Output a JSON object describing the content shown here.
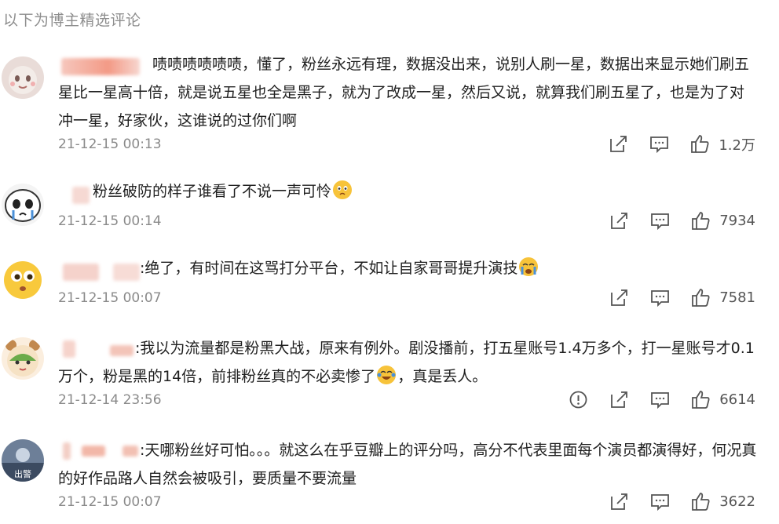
{
  "header": {
    "title": "以下为博主精选评论"
  },
  "comments": [
    {
      "text": "啧啧啧啧啧啧，懂了，粉丝永远有理，数据没出来，说别人刷一星，数据出来显示她们刷五星比一星高十倍，就是说五星也全是黑子，就为了改成一星，然后又说，就算我们刷五星了，也是为了对冲一星，好家伙，这谁说的过你们啊",
      "time": "21-12-15 00:13",
      "likes": "1.2万"
    },
    {
      "text": "粉丝破防的样子谁看了不说一声可怜",
      "time": "21-12-15 00:14",
      "likes": "7934"
    },
    {
      "text": ":绝了，有时间在这骂打分平台，不如让自家哥哥提升演技",
      "time": "21-12-15 00:07",
      "likes": "7581"
    },
    {
      "text_a": ":我以为流量都是粉黑大战，原来有例外。剧没播前，打五星账号1.4万多个，打一星账号才0.1万个，粉是黑的14倍，前排粉丝真的不必卖惨了",
      "text_b": "，真是丢人。",
      "time": "21-12-14 23:56",
      "likes": "6614"
    },
    {
      "text": ":天哪粉丝好可怕。。。就这么在乎豆瓣上的评分吗，高分不代表里面每个演员都演得好，何况真的好作品路人自然会被吸引，要质量不要流量",
      "time": "21-12-15 00:07",
      "likes": "3622",
      "avatar_text": "出警"
    }
  ]
}
